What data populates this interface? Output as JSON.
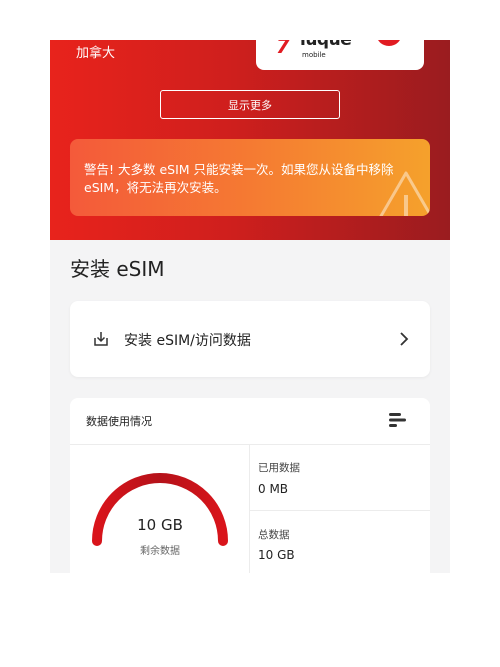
{
  "header": {
    "country": "加拿大",
    "logo_text": "luque",
    "logo_sub": "mobile",
    "show_more": "显示更多"
  },
  "warning": {
    "text": "警告! 大多数 eSIM 只能安装一次。如果您从设备中移除 eSIM，将无法再次安装。",
    "icon": "warning-triangle-icon"
  },
  "install_section": {
    "title": "安装 eSIM",
    "action_label": "安装 eSIM/访问数据"
  },
  "usage": {
    "title": "数据使用情况",
    "remaining_value": "10 GB",
    "remaining_label": "剩余数据",
    "remaining_fraction": 1.0,
    "used_label": "已用数据",
    "used_value": "0 MB",
    "total_label": "总数据",
    "total_value": "10 GB"
  },
  "colors": {
    "brand_red": "#e11b22",
    "warning_start": "#f45a3a",
    "warning_end": "#f5a12c"
  }
}
